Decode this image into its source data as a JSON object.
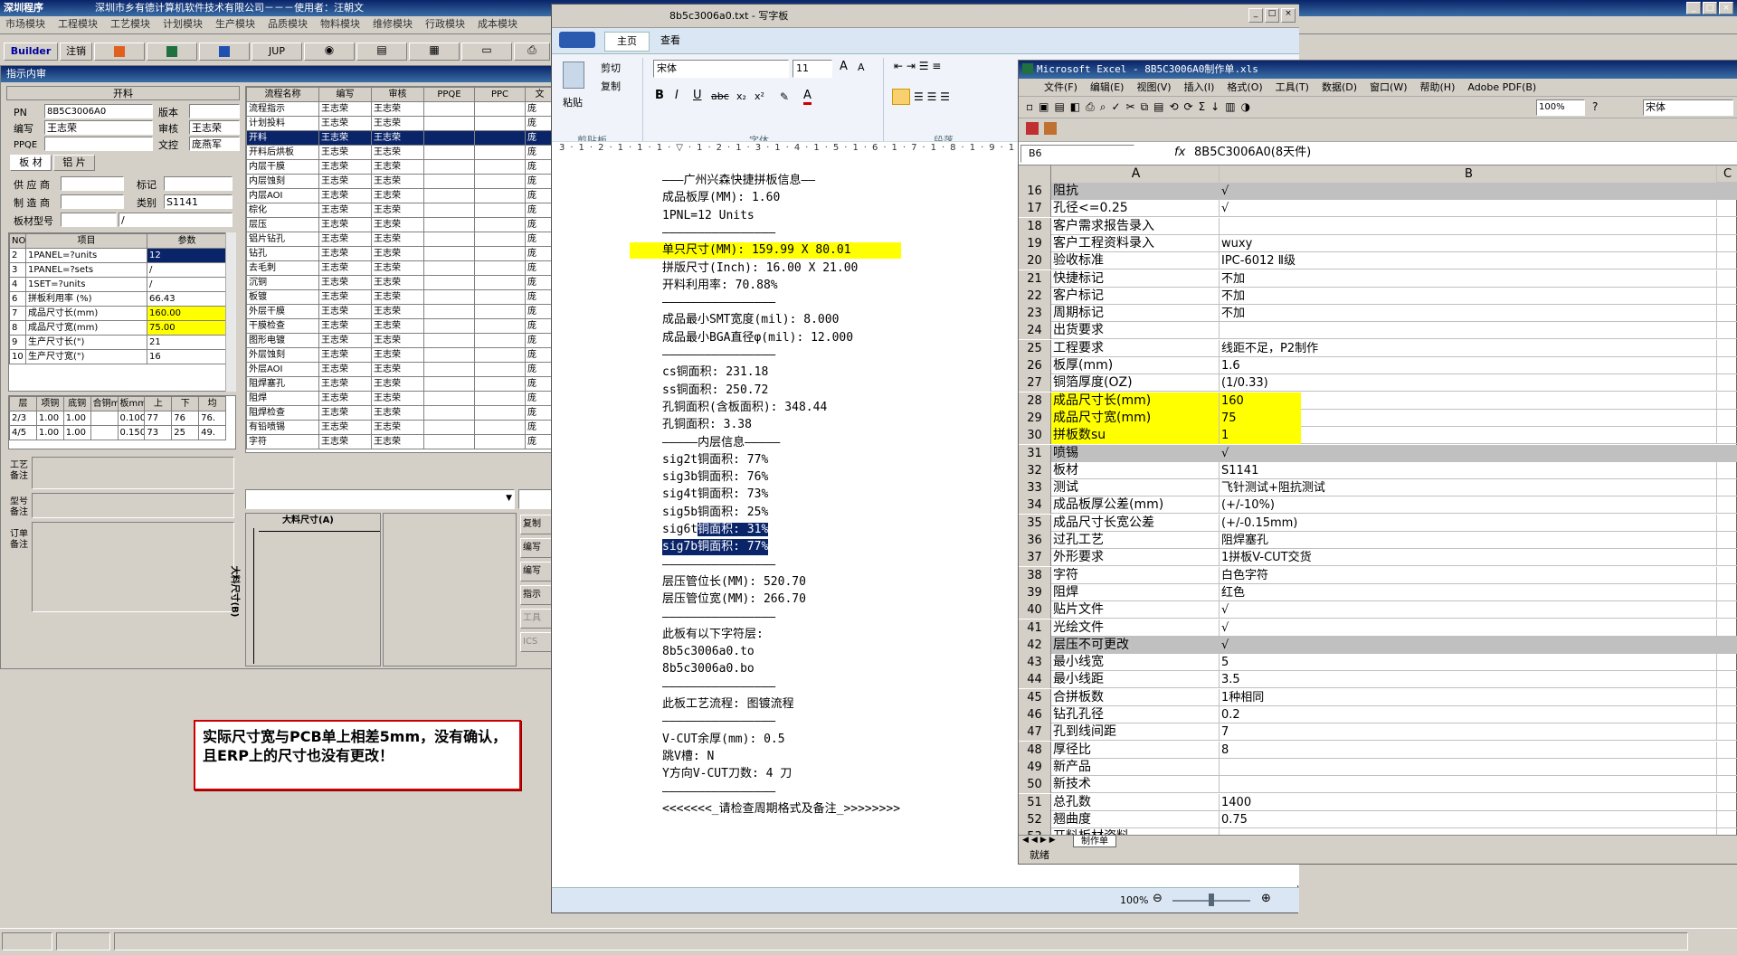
{
  "erp": {
    "title": "深圳程序",
    "company": "深圳市乡有德计算机软件技术有限公司－－－使用者：汪朝文",
    "menu": [
      "市场模块",
      "工程模块",
      "工艺模块",
      "计划模块",
      "生产模块",
      "品质模块",
      "物料模块",
      "维修模块",
      "行政模块",
      "成本模块"
    ],
    "toolbar": [
      "Builder",
      "注销",
      "JUP"
    ],
    "window_title": "指示内审",
    "section_label": "开料",
    "fields": {
      "pn_label": "PN",
      "pn": "8B5C3006A0",
      "version_label": "版本",
      "version": "",
      "editor_label": "编写",
      "editor": "王志荣",
      "reviewer_label": "审核",
      "reviewer": "王志荣",
      "ppqe_label": "PPQE",
      "ppqe": "",
      "doc_label": "文控",
      "doc": "庞燕军"
    },
    "tabs": [
      "板 材",
      "铝 片"
    ],
    "material": {
      "supplier_label": "供 应 商",
      "mark_label": "标记",
      "maker_label": "制 造 商",
      "class_label": "类别",
      "class": "S1141",
      "type_label": "板材型号",
      "type": "/"
    },
    "param_headers": [
      "NO",
      "项目",
      "参数"
    ],
    "params": [
      [
        "2",
        "1PANEL=?units",
        "12"
      ],
      [
        "3",
        "1PANEL=?sets",
        "/"
      ],
      [
        "4",
        "1SET=?units",
        "/"
      ],
      [
        "6",
        "拼板利用率 (%)",
        "66.43"
      ],
      [
        "7",
        "成品尺寸长(mm)",
        "160.00"
      ],
      [
        "8",
        "成品尺寸宽(mm)",
        "75.00"
      ],
      [
        "9",
        "生产尺寸长(\")",
        "21"
      ],
      [
        "10",
        "生产尺寸宽(\")",
        "16"
      ]
    ],
    "layer_headers": [
      "层",
      "项铜",
      "底铜",
      "合铜mm",
      "板mm",
      "上",
      "下",
      "均"
    ],
    "layers": [
      [
        "2/3",
        "1.00",
        "1.00",
        "",
        "0.100",
        "77",
        "76",
        "76."
      ],
      [
        "4/5",
        "1.00",
        "1.00",
        "",
        "0.150",
        "73",
        "25",
        "49."
      ]
    ],
    "notes": [
      "工艺备注",
      "型号备注",
      "订单备注"
    ],
    "process_headers": [
      "流程名称",
      "编写",
      "审核",
      "PPQE",
      "PPC",
      "文"
    ],
    "processes": [
      [
        "流程指示",
        "王志荣",
        "王志荣",
        "",
        "",
        "庞"
      ],
      [
        "计划投料",
        "王志荣",
        "王志荣",
        "",
        "",
        "庞"
      ],
      [
        "开料",
        "王志荣",
        "王志荣",
        "",
        "",
        "庞"
      ],
      [
        "开料后烘板",
        "王志荣",
        "王志荣",
        "",
        "",
        "庞"
      ],
      [
        "内层干膜",
        "王志荣",
        "王志荣",
        "",
        "",
        "庞"
      ],
      [
        "内层蚀刻",
        "王志荣",
        "王志荣",
        "",
        "",
        "庞"
      ],
      [
        "内层AOI",
        "王志荣",
        "王志荣",
        "",
        "",
        "庞"
      ],
      [
        "棕化",
        "王志荣",
        "王志荣",
        "",
        "",
        "庞"
      ],
      [
        "层压",
        "王志荣",
        "王志荣",
        "",
        "",
        "庞"
      ],
      [
        "铝片钻孔",
        "王志荣",
        "王志荣",
        "",
        "",
        "庞"
      ],
      [
        "钻孔",
        "王志荣",
        "王志荣",
        "",
        "",
        "庞"
      ],
      [
        "去毛刺",
        "王志荣",
        "王志荣",
        "",
        "",
        "庞"
      ],
      [
        "沉铜",
        "王志荣",
        "王志荣",
        "",
        "",
        "庞"
      ],
      [
        "板镀",
        "王志荣",
        "王志荣",
        "",
        "",
        "庞"
      ],
      [
        "外层干膜",
        "王志荣",
        "王志荣",
        "",
        "",
        "庞"
      ],
      [
        "干膜检查",
        "王志荣",
        "王志荣",
        "",
        "",
        "庞"
      ],
      [
        "图形电镀",
        "王志荣",
        "王志荣",
        "",
        "",
        "庞"
      ],
      [
        "外层蚀刻",
        "王志荣",
        "王志荣",
        "",
        "",
        "庞"
      ],
      [
        "外层AOI",
        "王志荣",
        "王志荣",
        "",
        "",
        "庞"
      ],
      [
        "阻焊塞孔",
        "王志荣",
        "王志荣",
        "",
        "",
        "庞"
      ],
      [
        "阻焊",
        "王志荣",
        "王志荣",
        "",
        "",
        "庞"
      ],
      [
        "阻焊检查",
        "王志荣",
        "王志荣",
        "",
        "",
        "庞"
      ],
      [
        "有铅喷锡",
        "王志荣",
        "王志荣",
        "",
        "",
        "庞"
      ],
      [
        "字符",
        "王志荣",
        "王志荣",
        "",
        "",
        "庞"
      ]
    ],
    "drawing": {
      "a_label": "大料尺寸(A)",
      "b_label": "大料尺寸(B)"
    },
    "side_buttons": [
      "复制",
      "编写",
      "编写",
      "指示",
      "工具",
      "ICS"
    ]
  },
  "callout": "实际尺寸宽与PCB单上相差5mm，没有确认，且ERP上的尺寸也没有更改！",
  "wordpad": {
    "title": "8b5c3006a0.txt - 写字板",
    "tabs": [
      "主页",
      "查看"
    ],
    "groups": [
      "剪贴板",
      "字体",
      "段落"
    ],
    "clipboard": {
      "paste": "粘贴",
      "cut": "剪切",
      "copy": "复制"
    },
    "font_name": "宋体",
    "font_size": "11",
    "zoom": "100%",
    "lines": [
      "———广州兴森快捷拼板信息——",
      "成品板厚(MM): 1.60",
      "1PNL=12 Units",
      "————————————————",
      "单只尺寸(MM): 159.99 X 80.01",
      "拼版尺寸(Inch): 16.00 X 21.00",
      "开料利用率: 70.88%",
      "————————————————",
      "成品最小SMT宽度(mil): 8.000",
      "成品最小BGA直径φ(mil): 12.000",
      "————————————————",
      "cs铜面积: 231.18",
      "ss铜面积: 250.72",
      "孔铜面积(含板面积): 348.44",
      "孔铜面积: 3.38",
      "—————内层信息—————",
      "sig2t铜面积: 77%",
      "sig3b铜面积: 76%",
      "sig4t铜面积: 73%",
      "sig5b铜面积: 25%",
      "sig6t铜面积: 31%",
      "sig7b铜面积: 77%",
      "————————————————",
      "层压管位长(MM): 520.70",
      "层压管位宽(MM): 266.70",
      "————————————————",
      "此板有以下字符层:",
      "8b5c3006a0.to",
      "8b5c3006a0.bo",
      "————————————————",
      "此板工艺流程: 图镀流程",
      "————————————————",
      "V-CUT余厚(mm): 0.5",
      "跳V槽: N",
      "Y方向V-CUT刀数: 4 刀",
      "————————————————",
      "<<<<<<<_请检查周期格式及备注_>>>>>>>>"
    ]
  },
  "excel": {
    "title": "Microsoft Excel - 8B5C3006A0制作单.xls",
    "menu": [
      "文件(F)",
      "编辑(E)",
      "视图(V)",
      "插入(I)",
      "格式(O)",
      "工具(T)",
      "数据(D)",
      "窗口(W)",
      "帮助(H)",
      "Adobe PDF(B)"
    ],
    "zoom": "100%",
    "font": "宋体",
    "name_box": "B6",
    "formula": "8B5C3006A0(8天件)",
    "columns": [
      "A",
      "B",
      "C"
    ],
    "rows": [
      [
        "16",
        "阻抗",
        "√"
      ],
      [
        "17",
        "孔径<=0.25",
        "√"
      ],
      [
        "18",
        "客户需求报告录入",
        ""
      ],
      [
        "19",
        "客户工程资料录入",
        "wuxy"
      ],
      [
        "20",
        "验收标准",
        "IPC-6012 Ⅱ级"
      ],
      [
        "21",
        "快捷标记",
        "不加"
      ],
      [
        "22",
        "客户标记",
        "不加"
      ],
      [
        "23",
        "周期标记",
        "不加"
      ],
      [
        "24",
        "出货要求",
        ""
      ],
      [
        "25",
        "工程要求",
        "线距不足，P2制作"
      ],
      [
        "26",
        "板厚(mm)",
        "1.6"
      ],
      [
        "27",
        "铜箔厚度(OZ)",
        "(1/0.33)"
      ],
      [
        "28",
        "成品尺寸长(mm)",
        "160"
      ],
      [
        "29",
        "成品尺寸宽(mm)",
        "75"
      ],
      [
        "30",
        "拼板数su",
        "1"
      ],
      [
        "31",
        "喷锡",
        "√"
      ],
      [
        "32",
        "板材",
        "S1141"
      ],
      [
        "33",
        "测试",
        "飞针测试+阻抗测试"
      ],
      [
        "34",
        "成品板厚公差(mm)",
        "(+/-10%)"
      ],
      [
        "35",
        "成品尺寸长宽公差",
        "(+/-0.15mm)"
      ],
      [
        "36",
        "过孔工艺",
        "阻焊塞孔"
      ],
      [
        "37",
        "外形要求",
        "1拼板V-CUT交货"
      ],
      [
        "38",
        "字符",
        "白色字符"
      ],
      [
        "39",
        "阻焊",
        "红色"
      ],
      [
        "40",
        "贴片文件",
        "√"
      ],
      [
        "41",
        "光绘文件",
        "√"
      ],
      [
        "42",
        "层压不可更改",
        "√"
      ],
      [
        "43",
        "最小线宽",
        "5"
      ],
      [
        "44",
        "最小线距",
        "3.5"
      ],
      [
        "45",
        "合拼板数",
        "1种相同"
      ],
      [
        "46",
        "钻孔孔径",
        "0.2"
      ],
      [
        "47",
        "孔到线间距",
        "7"
      ],
      [
        "48",
        "厚径比",
        "8"
      ],
      [
        "49",
        "新产品",
        ""
      ],
      [
        "50",
        "新技术",
        ""
      ],
      [
        "51",
        "总孔数",
        "1400"
      ],
      [
        "52",
        "翘曲度",
        "0.75"
      ],
      [
        "53",
        "开料板材资料",
        ""
      ]
    ],
    "sheet_tab": "制作单",
    "status": "就绪"
  }
}
